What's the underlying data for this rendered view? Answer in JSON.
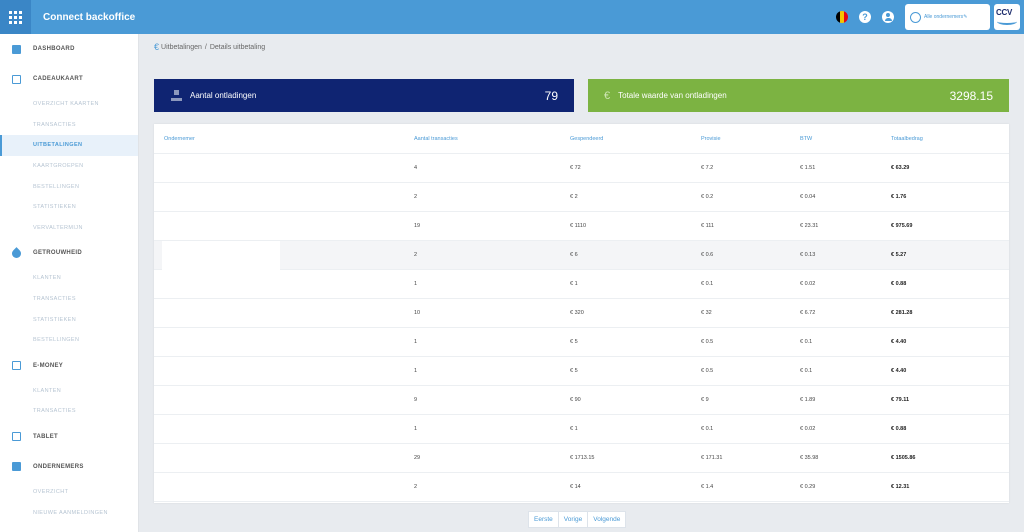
{
  "app": {
    "title": "Connect backoffice"
  },
  "topbar": {
    "tenant_label": "Alle ondernemers",
    "logo_text": "CCV",
    "help_icon": "?",
    "flag_colors": [
      "#000000",
      "#f5c400",
      "#e30613"
    ]
  },
  "colors": {
    "accent": "#4a9ad6",
    "primary_dark": "#0f2472",
    "success": "#7cb342"
  },
  "sidebar": {
    "sections": [
      {
        "label": "DASHBOARD",
        "icon": "dashboard-icon",
        "items": []
      },
      {
        "label": "CADEAUKAART",
        "icon": "giftcard-icon",
        "items": [
          {
            "label": "OVERZICHT KAARTEN",
            "active": false
          },
          {
            "label": "TRANSACTIES",
            "active": false
          },
          {
            "label": "UITBETALINGEN",
            "active": true
          },
          {
            "label": "KAARTGROEPEN",
            "active": false
          },
          {
            "label": "BESTELLINGEN",
            "active": false
          },
          {
            "label": "STATISTIEKEN",
            "active": false
          },
          {
            "label": "VERVALTERMIJN",
            "active": false
          }
        ]
      },
      {
        "label": "GETROUWHEID",
        "icon": "tag-icon",
        "items": [
          {
            "label": "KLANTEN",
            "active": false
          },
          {
            "label": "TRANSACTIES",
            "active": false
          },
          {
            "label": "STATISTIEKEN",
            "active": false
          },
          {
            "label": "BESTELLINGEN",
            "active": false
          }
        ]
      },
      {
        "label": "E-MONEY",
        "icon": "card-icon",
        "items": [
          {
            "label": "KLANTEN",
            "active": false
          },
          {
            "label": "TRANSACTIES",
            "active": false
          }
        ]
      },
      {
        "label": "TABLET",
        "icon": "tablet-icon",
        "items": []
      },
      {
        "label": "ONDERNEMERS",
        "icon": "store-icon",
        "items": [
          {
            "label": "OVERZICHT",
            "active": false
          },
          {
            "label": "NIEUWE AANMELDINGEN",
            "active": false
          }
        ]
      }
    ]
  },
  "breadcrumb": {
    "root": "Uitbetalingen",
    "separator": "/",
    "current": "Details uitbetaling"
  },
  "stats": {
    "count": {
      "label": "Aantal ontladingen",
      "value": "79"
    },
    "total": {
      "label": "Totale waarde van ontladingen",
      "value": "3298.15"
    }
  },
  "table": {
    "headers": [
      "Ondernemer",
      "Aantal transacties",
      "Gespendeerd",
      "Provisie",
      "BTW",
      "Totaalbedrag"
    ],
    "rows": [
      [
        "",
        "4",
        "€ 72",
        "€ 7.2",
        "€ 1.51",
        "€ 63.29"
      ],
      [
        "",
        "2",
        "€ 2",
        "€ 0.2",
        "€ 0.04",
        "€ 1.76"
      ],
      [
        "",
        "19",
        "€ 1110",
        "€ 111",
        "€ 23.31",
        "€ 975.69"
      ],
      [
        "",
        "2",
        "€ 6",
        "€ 0.6",
        "€ 0.13",
        "€ 5.27"
      ],
      [
        "",
        "1",
        "€ 1",
        "€ 0.1",
        "€ 0.02",
        "€ 0.88"
      ],
      [
        "",
        "10",
        "€ 320",
        "€ 32",
        "€ 6.72",
        "€ 281.28"
      ],
      [
        "",
        "1",
        "€ 5",
        "€ 0.5",
        "€ 0.1",
        "€ 4.40"
      ],
      [
        "",
        "1",
        "€ 5",
        "€ 0.5",
        "€ 0.1",
        "€ 4.40"
      ],
      [
        "",
        "9",
        "€ 90",
        "€ 9",
        "€ 1.89",
        "€ 79.11"
      ],
      [
        "",
        "1",
        "€ 1",
        "€ 0.1",
        "€ 0.02",
        "€ 0.88"
      ],
      [
        "",
        "29",
        "€ 1713.15",
        "€ 171.31",
        "€ 35.98",
        "€ 1505.86"
      ],
      [
        "",
        "2",
        "€ 14",
        "€ 1.4",
        "€ 0.29",
        "€ 12.31"
      ]
    ]
  },
  "pagination": {
    "first": "Eerste",
    "prev": "Vorige",
    "next": "Volgende"
  }
}
